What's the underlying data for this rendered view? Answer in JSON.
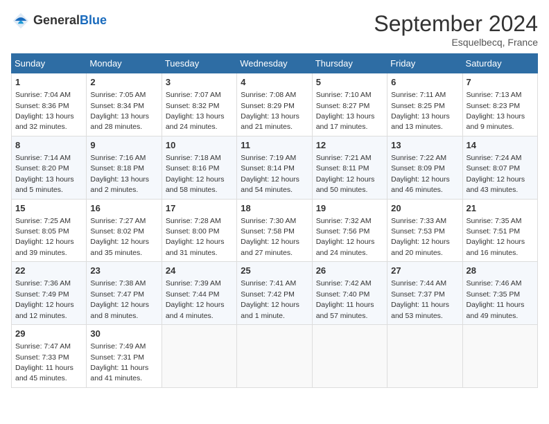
{
  "logo": {
    "general": "General",
    "blue": "Blue"
  },
  "title": "September 2024",
  "location": "Esquelbecq, France",
  "headers": [
    "Sunday",
    "Monday",
    "Tuesday",
    "Wednesday",
    "Thursday",
    "Friday",
    "Saturday"
  ],
  "weeks": [
    [
      {
        "day": "1",
        "sunrise": "Sunrise: 7:04 AM",
        "sunset": "Sunset: 8:36 PM",
        "daylight": "Daylight: 13 hours and 32 minutes."
      },
      {
        "day": "2",
        "sunrise": "Sunrise: 7:05 AM",
        "sunset": "Sunset: 8:34 PM",
        "daylight": "Daylight: 13 hours and 28 minutes."
      },
      {
        "day": "3",
        "sunrise": "Sunrise: 7:07 AM",
        "sunset": "Sunset: 8:32 PM",
        "daylight": "Daylight: 13 hours and 24 minutes."
      },
      {
        "day": "4",
        "sunrise": "Sunrise: 7:08 AM",
        "sunset": "Sunset: 8:29 PM",
        "daylight": "Daylight: 13 hours and 21 minutes."
      },
      {
        "day": "5",
        "sunrise": "Sunrise: 7:10 AM",
        "sunset": "Sunset: 8:27 PM",
        "daylight": "Daylight: 13 hours and 17 minutes."
      },
      {
        "day": "6",
        "sunrise": "Sunrise: 7:11 AM",
        "sunset": "Sunset: 8:25 PM",
        "daylight": "Daylight: 13 hours and 13 minutes."
      },
      {
        "day": "7",
        "sunrise": "Sunrise: 7:13 AM",
        "sunset": "Sunset: 8:23 PM",
        "daylight": "Daylight: 13 hours and 9 minutes."
      }
    ],
    [
      {
        "day": "8",
        "sunrise": "Sunrise: 7:14 AM",
        "sunset": "Sunset: 8:20 PM",
        "daylight": "Daylight: 13 hours and 5 minutes."
      },
      {
        "day": "9",
        "sunrise": "Sunrise: 7:16 AM",
        "sunset": "Sunset: 8:18 PM",
        "daylight": "Daylight: 13 hours and 2 minutes."
      },
      {
        "day": "10",
        "sunrise": "Sunrise: 7:18 AM",
        "sunset": "Sunset: 8:16 PM",
        "daylight": "Daylight: 12 hours and 58 minutes."
      },
      {
        "day": "11",
        "sunrise": "Sunrise: 7:19 AM",
        "sunset": "Sunset: 8:14 PM",
        "daylight": "Daylight: 12 hours and 54 minutes."
      },
      {
        "day": "12",
        "sunrise": "Sunrise: 7:21 AM",
        "sunset": "Sunset: 8:11 PM",
        "daylight": "Daylight: 12 hours and 50 minutes."
      },
      {
        "day": "13",
        "sunrise": "Sunrise: 7:22 AM",
        "sunset": "Sunset: 8:09 PM",
        "daylight": "Daylight: 12 hours and 46 minutes."
      },
      {
        "day": "14",
        "sunrise": "Sunrise: 7:24 AM",
        "sunset": "Sunset: 8:07 PM",
        "daylight": "Daylight: 12 hours and 43 minutes."
      }
    ],
    [
      {
        "day": "15",
        "sunrise": "Sunrise: 7:25 AM",
        "sunset": "Sunset: 8:05 PM",
        "daylight": "Daylight: 12 hours and 39 minutes."
      },
      {
        "day": "16",
        "sunrise": "Sunrise: 7:27 AM",
        "sunset": "Sunset: 8:02 PM",
        "daylight": "Daylight: 12 hours and 35 minutes."
      },
      {
        "day": "17",
        "sunrise": "Sunrise: 7:28 AM",
        "sunset": "Sunset: 8:00 PM",
        "daylight": "Daylight: 12 hours and 31 minutes."
      },
      {
        "day": "18",
        "sunrise": "Sunrise: 7:30 AM",
        "sunset": "Sunset: 7:58 PM",
        "daylight": "Daylight: 12 hours and 27 minutes."
      },
      {
        "day": "19",
        "sunrise": "Sunrise: 7:32 AM",
        "sunset": "Sunset: 7:56 PM",
        "daylight": "Daylight: 12 hours and 24 minutes."
      },
      {
        "day": "20",
        "sunrise": "Sunrise: 7:33 AM",
        "sunset": "Sunset: 7:53 PM",
        "daylight": "Daylight: 12 hours and 20 minutes."
      },
      {
        "day": "21",
        "sunrise": "Sunrise: 7:35 AM",
        "sunset": "Sunset: 7:51 PM",
        "daylight": "Daylight: 12 hours and 16 minutes."
      }
    ],
    [
      {
        "day": "22",
        "sunrise": "Sunrise: 7:36 AM",
        "sunset": "Sunset: 7:49 PM",
        "daylight": "Daylight: 12 hours and 12 minutes."
      },
      {
        "day": "23",
        "sunrise": "Sunrise: 7:38 AM",
        "sunset": "Sunset: 7:47 PM",
        "daylight": "Daylight: 12 hours and 8 minutes."
      },
      {
        "day": "24",
        "sunrise": "Sunrise: 7:39 AM",
        "sunset": "Sunset: 7:44 PM",
        "daylight": "Daylight: 12 hours and 4 minutes."
      },
      {
        "day": "25",
        "sunrise": "Sunrise: 7:41 AM",
        "sunset": "Sunset: 7:42 PM",
        "daylight": "Daylight: 12 hours and 1 minute."
      },
      {
        "day": "26",
        "sunrise": "Sunrise: 7:42 AM",
        "sunset": "Sunset: 7:40 PM",
        "daylight": "Daylight: 11 hours and 57 minutes."
      },
      {
        "day": "27",
        "sunrise": "Sunrise: 7:44 AM",
        "sunset": "Sunset: 7:37 PM",
        "daylight": "Daylight: 11 hours and 53 minutes."
      },
      {
        "day": "28",
        "sunrise": "Sunrise: 7:46 AM",
        "sunset": "Sunset: 7:35 PM",
        "daylight": "Daylight: 11 hours and 49 minutes."
      }
    ],
    [
      {
        "day": "29",
        "sunrise": "Sunrise: 7:47 AM",
        "sunset": "Sunset: 7:33 PM",
        "daylight": "Daylight: 11 hours and 45 minutes."
      },
      {
        "day": "30",
        "sunrise": "Sunrise: 7:49 AM",
        "sunset": "Sunset: 7:31 PM",
        "daylight": "Daylight: 11 hours and 41 minutes."
      },
      null,
      null,
      null,
      null,
      null
    ]
  ]
}
